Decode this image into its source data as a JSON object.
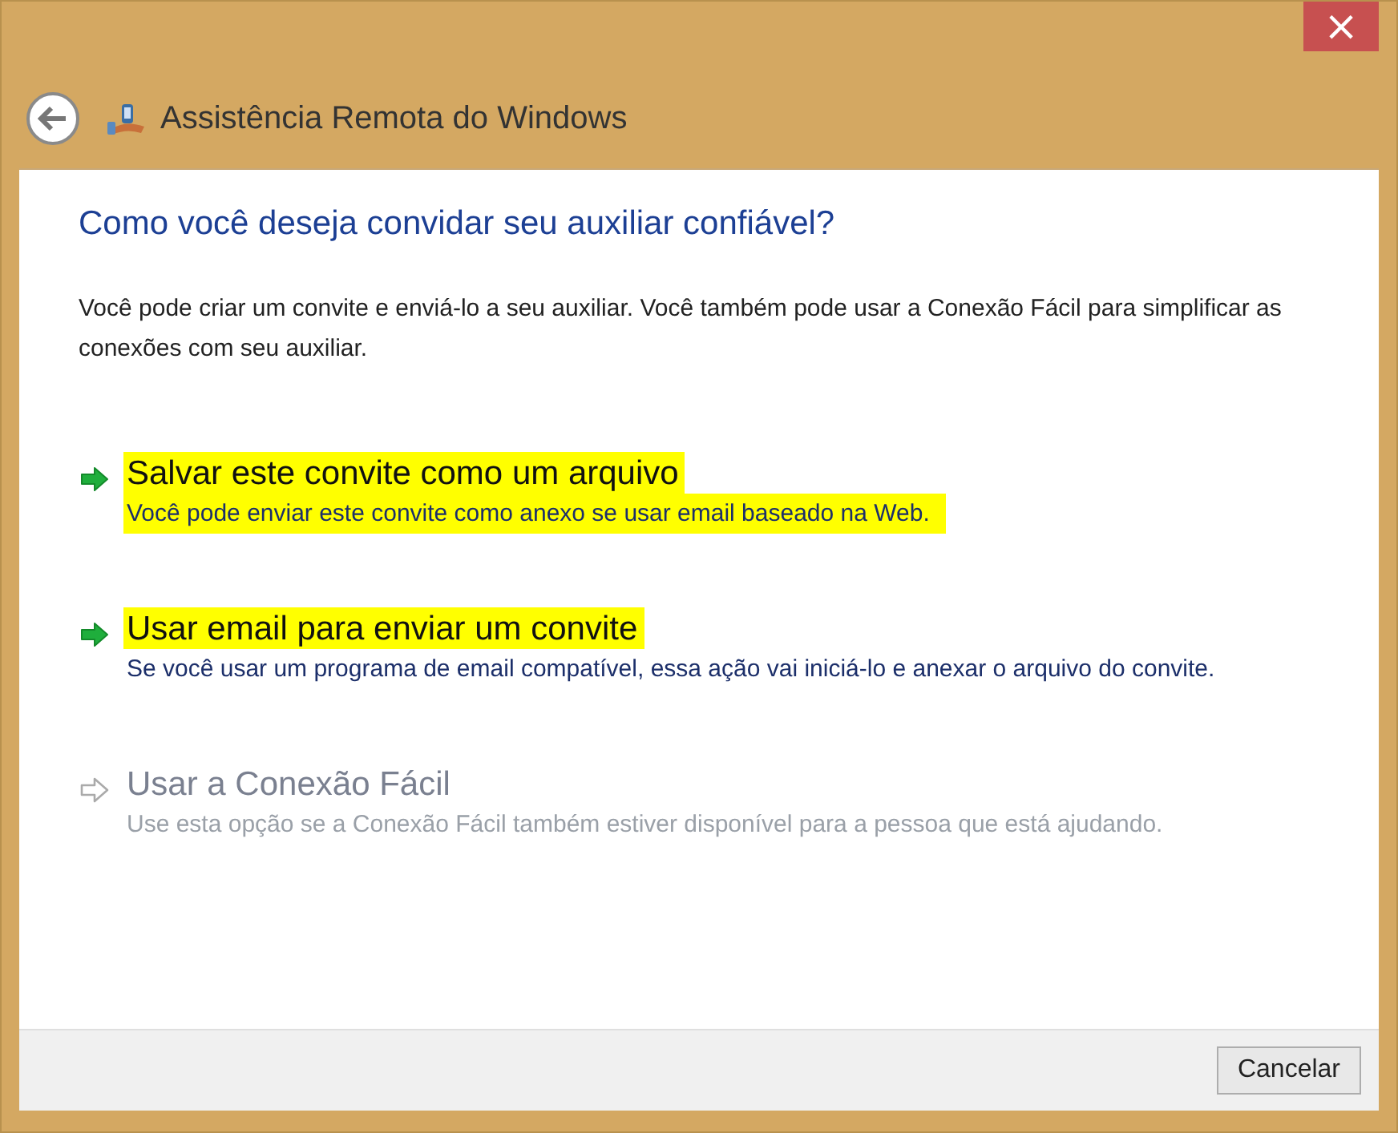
{
  "window": {
    "title": "Assistência Remota do Windows",
    "close_label": "×"
  },
  "heading": "Como você deseja convidar seu auxiliar confiável?",
  "intro": "Você pode criar um convite e enviá-lo a seu auxiliar. Você também pode usar a Conexão Fácil para simplificar as conexões com seu auxiliar.",
  "options": [
    {
      "title": "Salvar este convite como um arquivo",
      "description": "Você pode enviar este convite como anexo se usar email baseado na Web.",
      "disabled": false,
      "title_highlighted": true,
      "description_highlighted": true
    },
    {
      "title": "Usar email para enviar um convite",
      "description": "Se você usar um programa de email compatível, essa ação vai iniciá-lo e anexar o arquivo do convite.",
      "disabled": false,
      "title_highlighted": true,
      "description_highlighted": false
    },
    {
      "title": "Usar a Conexão Fácil",
      "description": "Use esta opção se a Conexão Fácil também estiver disponível para a pessoa que está ajudando.",
      "disabled": true,
      "title_highlighted": false,
      "description_highlighted": false
    }
  ],
  "buttons": [
    {
      "label": "Cancelar"
    }
  ]
}
